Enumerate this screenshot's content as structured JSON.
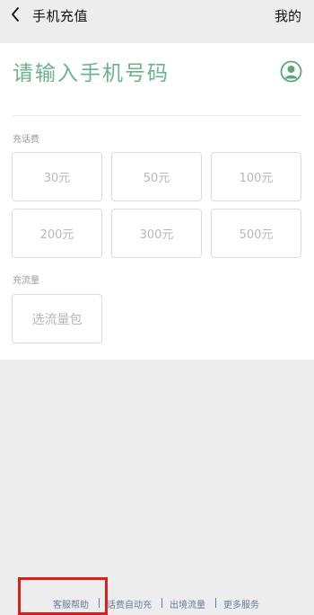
{
  "header": {
    "title": "手机充值",
    "mine_label": "我的"
  },
  "phone": {
    "placeholder": "请输入手机号码"
  },
  "topup": {
    "label": "充话费",
    "options": [
      "30元",
      "50元",
      "100元",
      "200元",
      "300元",
      "500元"
    ]
  },
  "data_plan": {
    "label": "充流量",
    "option": "选流量包"
  },
  "footer": {
    "links": [
      "客服帮助",
      "话费自动充",
      "出境流量",
      "更多服务"
    ]
  },
  "colors": {
    "accent": "#5aa77a",
    "highlight": "#d81e1e",
    "footer_link": "#6b7a99"
  }
}
